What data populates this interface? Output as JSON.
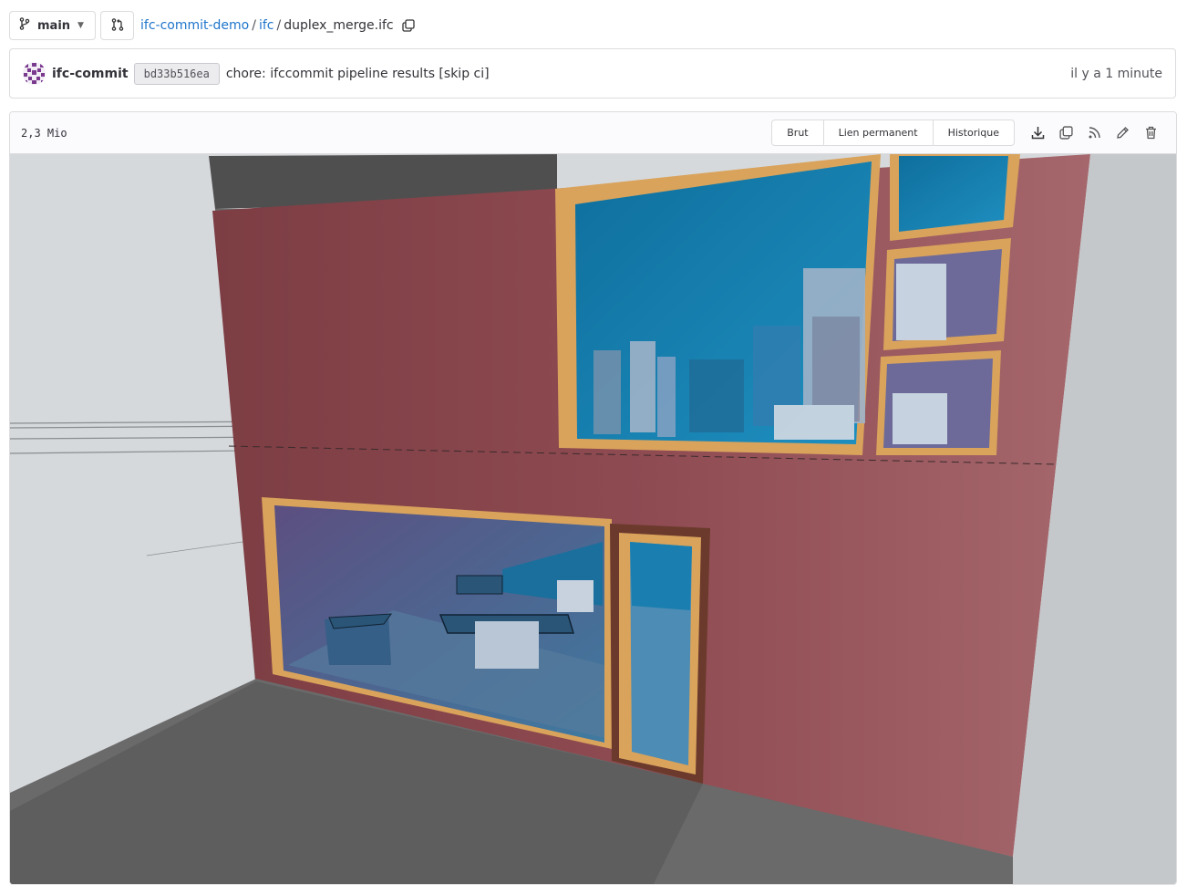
{
  "branch": {
    "name": "main",
    "icon": "branch-icon"
  },
  "merge_request_icon": "merge-request-icon",
  "breadcrumb": {
    "project": "ifc-commit-demo",
    "folder": "ifc",
    "file": "duplex_merge.ifc",
    "separator": "/"
  },
  "commit": {
    "author": "ifc-commit",
    "sha": "bd33b516ea",
    "message": "chore: ifccommit pipeline results [skip ci]",
    "time": "il y a 1 minute"
  },
  "file": {
    "size": "2,3 Mio",
    "buttons": {
      "raw": "Brut",
      "permalink": "Lien permanent",
      "history": "Historique"
    },
    "icons": [
      "download-icon",
      "copy-contents-icon",
      "rss-icon",
      "edit-icon",
      "delete-icon"
    ]
  },
  "colors": {
    "link": "#1f75cb",
    "wall": "#9a5050",
    "glass": "#1a7fb0",
    "frame": "#d9a35c"
  }
}
